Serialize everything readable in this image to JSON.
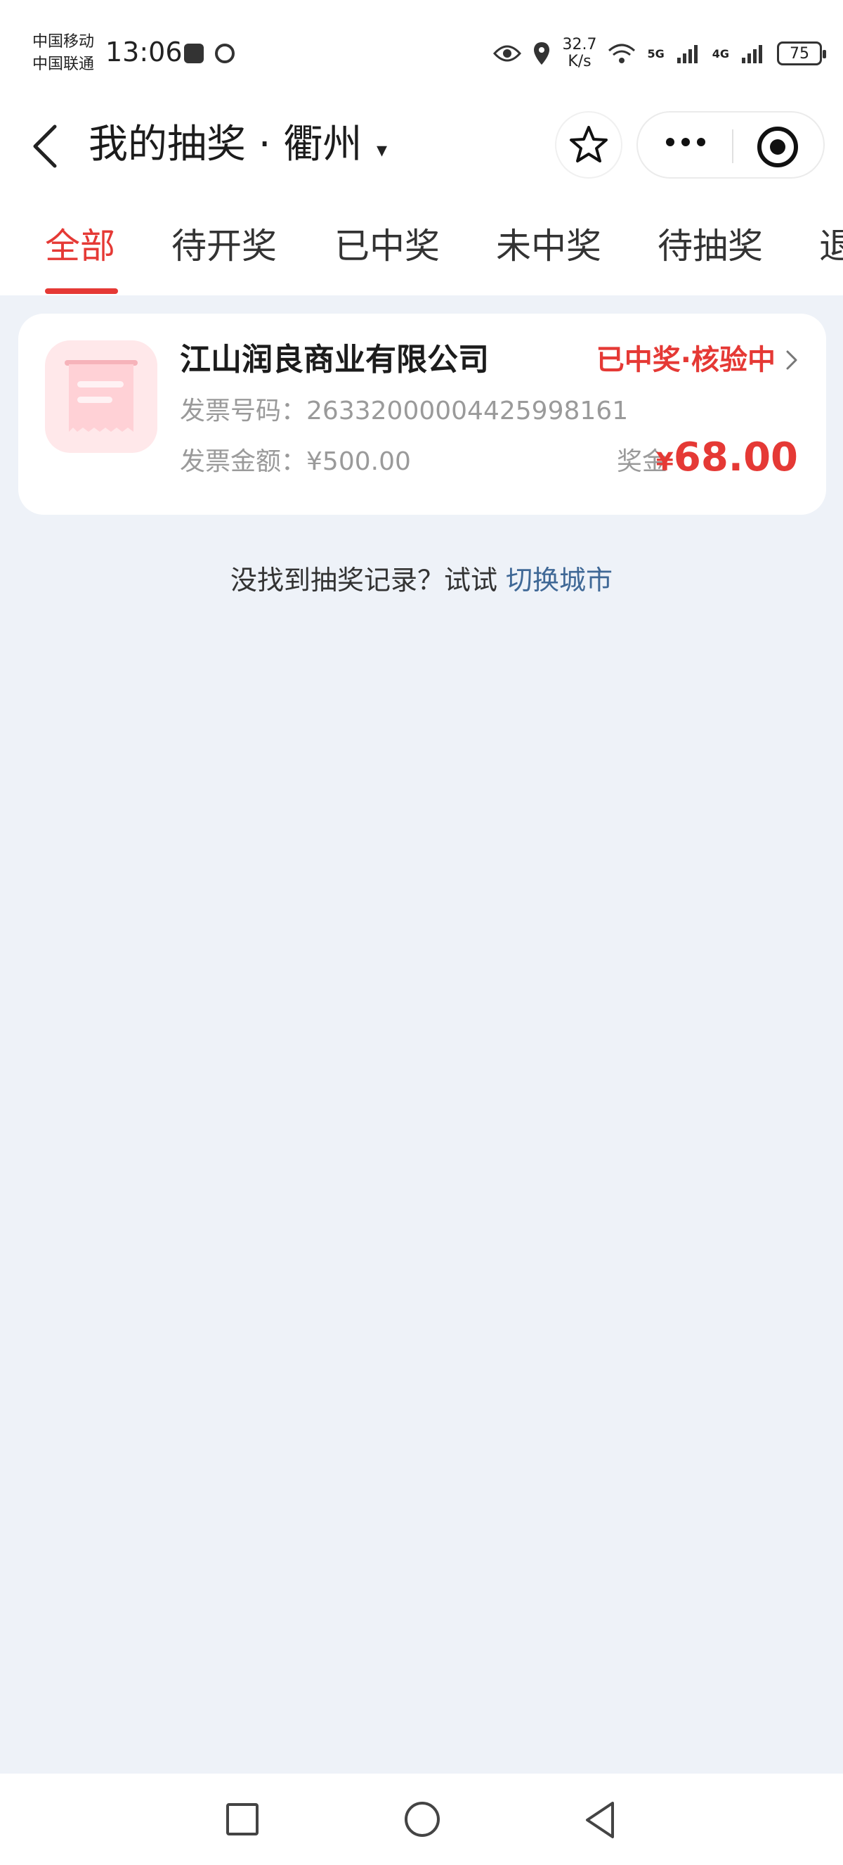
{
  "status_bar": {
    "carrier_1": "中国移动",
    "carrier_2": "中国联通",
    "time": "13:06",
    "speed_value": "32.7",
    "speed_unit": "K/s",
    "network_1": "5G",
    "network_2": "4G",
    "battery": "75"
  },
  "header": {
    "title": "我的抽奖 · 衢州",
    "caret": "▾"
  },
  "tabs": [
    {
      "label": "全部",
      "active": true
    },
    {
      "label": "待开奖",
      "active": false
    },
    {
      "label": "已中奖",
      "active": false
    },
    {
      "label": "未中奖",
      "active": false
    },
    {
      "label": "待抽奖",
      "active": false
    },
    {
      "label": "退",
      "active": false
    }
  ],
  "records": [
    {
      "merchant": "江山润良商业有限公司",
      "status": "已中奖·核验中",
      "invoice_number_label": "发票号码：",
      "invoice_number": "26332000004425998161",
      "invoice_amount_label": "发票金额：",
      "invoice_amount": "¥500.00",
      "prize_label": "奖金",
      "prize_currency": "¥",
      "prize_amount": "68.00"
    }
  ],
  "hint": {
    "text": "没找到抽奖记录？试试 ",
    "link": "切换城市"
  },
  "colors": {
    "accent": "#e53935",
    "link": "#3f6896",
    "background": "#eef2f8"
  },
  "icons": {
    "back": "chevron-left-icon",
    "favorite": "star-icon",
    "more": "more-dots-icon",
    "close": "target-icon",
    "receipt": "receipt-icon",
    "nav_recent": "square-icon",
    "nav_home": "circle-icon",
    "nav_back": "triangle-back-icon"
  }
}
